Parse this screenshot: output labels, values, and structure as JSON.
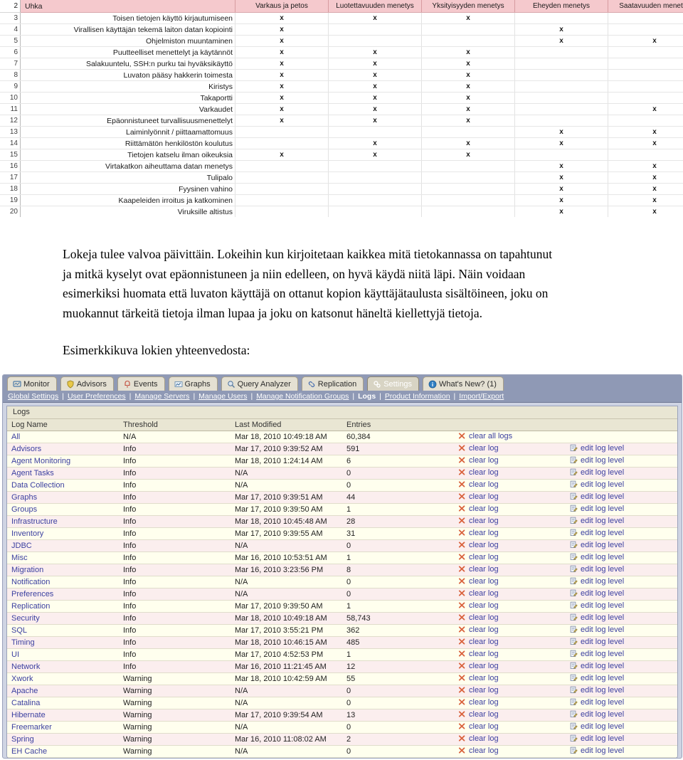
{
  "threat_table": {
    "columns": [
      "Uhka",
      "Varkaus ja petos",
      "Luotettavuuden menetys",
      "Yksityisyyden menetys",
      "Eheyden menetys",
      "Saatavuuden menetys"
    ],
    "header_row_number": "2",
    "mark": "x",
    "rows": [
      {
        "n": "3",
        "threat": "Toisen tietojen käyttö kirjautumiseen",
        "marks": [
          true,
          true,
          true,
          false,
          false
        ]
      },
      {
        "n": "4",
        "threat": "Virallisen käyttäjän tekemä laiton datan kopiointi",
        "marks": [
          true,
          false,
          false,
          true,
          false
        ]
      },
      {
        "n": "5",
        "threat": "Ohjelmiston muuntaminen",
        "marks": [
          true,
          false,
          false,
          true,
          true
        ]
      },
      {
        "n": "6",
        "threat": "Puutteelliset menettelyt ja käytännöt",
        "marks": [
          true,
          true,
          true,
          false,
          false
        ]
      },
      {
        "n": "7",
        "threat": "Salakuuntelu, SSH:n purku tai hyväksikäyttö",
        "marks": [
          true,
          true,
          true,
          false,
          false
        ]
      },
      {
        "n": "8",
        "threat": "Luvaton pääsy hakkerin toimesta",
        "marks": [
          true,
          true,
          true,
          false,
          false
        ]
      },
      {
        "n": "9",
        "threat": "Kiristys",
        "marks": [
          true,
          true,
          true,
          false,
          false
        ]
      },
      {
        "n": "10",
        "threat": "Takaportti",
        "marks": [
          true,
          true,
          true,
          false,
          false
        ]
      },
      {
        "n": "11",
        "threat": "Varkaudet",
        "marks": [
          true,
          true,
          true,
          false,
          true
        ]
      },
      {
        "n": "12",
        "threat": "Epäonnistuneet turvallisuusmenettelyt",
        "marks": [
          true,
          true,
          true,
          false,
          false
        ]
      },
      {
        "n": "13",
        "threat": "Laiminlyönnit / piittaamattomuus",
        "marks": [
          false,
          false,
          false,
          true,
          true
        ]
      },
      {
        "n": "14",
        "threat": "Riittämätön henkilöstön koulutus",
        "marks": [
          false,
          true,
          true,
          true,
          true
        ]
      },
      {
        "n": "15",
        "threat": "Tietojen katselu ilman oikeuksia",
        "marks": [
          true,
          true,
          true,
          false,
          false
        ]
      },
      {
        "n": "16",
        "threat": "Virtakatkon aiheuttama datan menetys",
        "marks": [
          false,
          false,
          false,
          true,
          true
        ]
      },
      {
        "n": "17",
        "threat": "Tulipalo",
        "marks": [
          false,
          false,
          false,
          true,
          true
        ]
      },
      {
        "n": "18",
        "threat": "Fyysinen vahino",
        "marks": [
          false,
          false,
          false,
          true,
          true
        ]
      },
      {
        "n": "19",
        "threat": "Kaapeleiden irroitus ja katkominen",
        "marks": [
          false,
          false,
          false,
          true,
          true
        ]
      },
      {
        "n": "20",
        "threat": "Viruksille altistus",
        "marks": [
          false,
          false,
          false,
          true,
          true
        ]
      }
    ]
  },
  "prose": {
    "paragraph1": "Lokeja tulee valvoa päivittäin. Lokeihin kun kirjoitetaan kaikkea mitä tietokannassa on tapahtunut ja mitkä kyselyt ovat epäonnistuneen ja niin edelleen, on hyvä käydä niitä läpi. Näin voidaan esimerkiksi huomata että luvaton käyttäjä on ottanut kopion käyttäjätaulusta sisältöineen, joku on muokannut tärkeitä tietoja ilman lupaa ja joku on katsonut häneltä kiellettyjä tietoja.",
    "paragraph2": "Esimerkkikuva lokien yhteenvedosta:"
  },
  "monitor": {
    "tabs": [
      {
        "label": "Monitor",
        "icon": "monitor-icon",
        "active": false
      },
      {
        "label": "Advisors",
        "icon": "shield-icon",
        "active": false
      },
      {
        "label": "Events",
        "icon": "bell-icon",
        "active": false
      },
      {
        "label": "Graphs",
        "icon": "chart-icon",
        "active": false
      },
      {
        "label": "Query Analyzer",
        "icon": "magnifier-icon",
        "active": false
      },
      {
        "label": "Replication",
        "icon": "link-icon",
        "active": false
      },
      {
        "label": "Settings",
        "icon": "gears-icon",
        "active": true
      },
      {
        "label": "What's New? (1)",
        "icon": "info-icon",
        "active": false
      }
    ],
    "subnav": [
      {
        "label": "Global Settings",
        "current": false
      },
      {
        "label": "User Preferences",
        "current": false
      },
      {
        "label": "Manage Servers",
        "current": false
      },
      {
        "label": "Manage Users",
        "current": false
      },
      {
        "label": "Manage Notification Groups",
        "current": false
      },
      {
        "label": "Logs",
        "current": true
      },
      {
        "label": "Product Information",
        "current": false
      },
      {
        "label": "Import/Export",
        "current": false
      }
    ],
    "subnav_separator": "|",
    "panel_title": "Logs",
    "columns": [
      "Log Name",
      "Threshold",
      "Last Modified",
      "Entries",
      "",
      ""
    ],
    "action_clear_all": "clear all logs",
    "action_clear": "clear log",
    "action_edit": "edit log level",
    "rows": [
      {
        "name": "All",
        "threshold": "N/A",
        "modified": "Mar 18, 2010 10:49:18 AM",
        "entries": "60,384",
        "clear_all": true
      },
      {
        "name": "Advisors",
        "threshold": "Info",
        "modified": "Mar 17, 2010 9:39:52 AM",
        "entries": "591",
        "clear_all": false
      },
      {
        "name": "Agent Monitoring",
        "threshold": "Info",
        "modified": "Mar 18, 2010 1:24:14 AM",
        "entries": "6",
        "clear_all": false
      },
      {
        "name": "Agent Tasks",
        "threshold": "Info",
        "modified": "N/A",
        "entries": "0",
        "clear_all": false
      },
      {
        "name": "Data Collection",
        "threshold": "Info",
        "modified": "N/A",
        "entries": "0",
        "clear_all": false
      },
      {
        "name": "Graphs",
        "threshold": "Info",
        "modified": "Mar 17, 2010 9:39:51 AM",
        "entries": "44",
        "clear_all": false
      },
      {
        "name": "Groups",
        "threshold": "Info",
        "modified": "Mar 17, 2010 9:39:50 AM",
        "entries": "1",
        "clear_all": false
      },
      {
        "name": "Infrastructure",
        "threshold": "Info",
        "modified": "Mar 18, 2010 10:45:48 AM",
        "entries": "28",
        "clear_all": false
      },
      {
        "name": "Inventory",
        "threshold": "Info",
        "modified": "Mar 17, 2010 9:39:55 AM",
        "entries": "31",
        "clear_all": false
      },
      {
        "name": "JDBC",
        "threshold": "Info",
        "modified": "N/A",
        "entries": "0",
        "clear_all": false
      },
      {
        "name": "Misc",
        "threshold": "Info",
        "modified": "Mar 16, 2010 10:53:51 AM",
        "entries": "1",
        "clear_all": false
      },
      {
        "name": "Migration",
        "threshold": "Info",
        "modified": "Mar 16, 2010 3:23:56 PM",
        "entries": "8",
        "clear_all": false
      },
      {
        "name": "Notification",
        "threshold": "Info",
        "modified": "N/A",
        "entries": "0",
        "clear_all": false
      },
      {
        "name": "Preferences",
        "threshold": "Info",
        "modified": "N/A",
        "entries": "0",
        "clear_all": false
      },
      {
        "name": "Replication",
        "threshold": "Info",
        "modified": "Mar 17, 2010 9:39:50 AM",
        "entries": "1",
        "clear_all": false
      },
      {
        "name": "Security",
        "threshold": "Info",
        "modified": "Mar 18, 2010 10:49:18 AM",
        "entries": "58,743",
        "clear_all": false
      },
      {
        "name": "SQL",
        "threshold": "Info",
        "modified": "Mar 17, 2010 3:55:21 PM",
        "entries": "362",
        "clear_all": false
      },
      {
        "name": "Timing",
        "threshold": "Info",
        "modified": "Mar 18, 2010 10:46:15 AM",
        "entries": "485",
        "clear_all": false
      },
      {
        "name": "UI",
        "threshold": "Info",
        "modified": "Mar 17, 2010 4:52:53 PM",
        "entries": "1",
        "clear_all": false
      },
      {
        "name": "Network",
        "threshold": "Info",
        "modified": "Mar 16, 2010 11:21:45 AM",
        "entries": "12",
        "clear_all": false
      },
      {
        "name": "Xwork",
        "threshold": "Warning",
        "modified": "Mar 18, 2010 10:42:59 AM",
        "entries": "55",
        "clear_all": false
      },
      {
        "name": "Apache",
        "threshold": "Warning",
        "modified": "N/A",
        "entries": "0",
        "clear_all": false
      },
      {
        "name": "Catalina",
        "threshold": "Warning",
        "modified": "N/A",
        "entries": "0",
        "clear_all": false
      },
      {
        "name": "Hibernate",
        "threshold": "Warning",
        "modified": "Mar 17, 2010 9:39:54 AM",
        "entries": "13",
        "clear_all": false
      },
      {
        "name": "Freemarker",
        "threshold": "Warning",
        "modified": "N/A",
        "entries": "0",
        "clear_all": false
      },
      {
        "name": "Spring",
        "threshold": "Warning",
        "modified": "Mar 16, 2010 11:08:02 AM",
        "entries": "2",
        "clear_all": false
      },
      {
        "name": "EH Cache",
        "threshold": "Warning",
        "modified": "N/A",
        "entries": "0",
        "clear_all": false
      }
    ]
  },
  "colors": {
    "excel_header_pink": "#f5c9cd",
    "mem_chrome_blue": "#8f99b5",
    "mem_tab_tan": "#e4e0d2",
    "row_even_yellow": "#ffffee",
    "row_odd_pink": "#fbeeee",
    "link_blue": "#3b3fa0",
    "clear_icon_orange": "#d9613c"
  }
}
